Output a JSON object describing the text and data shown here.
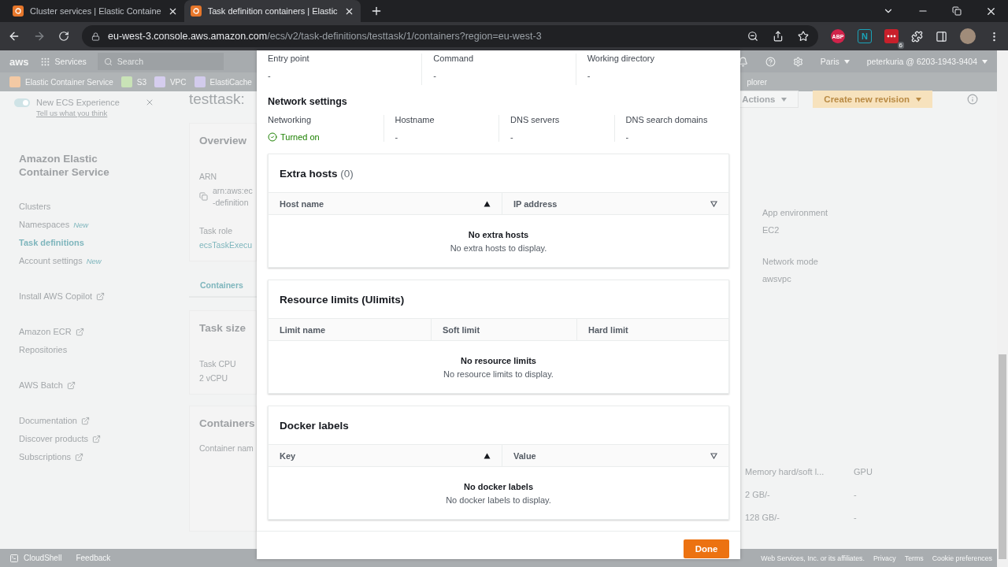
{
  "browser": {
    "tabs": [
      {
        "title": "Cluster services | Elastic Containe",
        "selected": false
      },
      {
        "title": "Task definition containers | Elastic",
        "selected": true
      }
    ],
    "address": {
      "host": "eu-west-3.console.aws.amazon.com",
      "path": "/ecs/v2/task-definitions/testtask/1/containers?region=eu-west-3"
    },
    "extensions": [
      {
        "kind": "abp",
        "label": "ABP"
      },
      {
        "kind": "notion",
        "label": "N"
      },
      {
        "kind": "dots",
        "label": "6"
      }
    ]
  },
  "console": {
    "header": {
      "logo": "aws",
      "services": "Services",
      "search_placeholder": "Search",
      "region": "Paris",
      "account": "peterkuria @ 6203-1943-9404"
    },
    "favorites": [
      {
        "label": "Elastic Container Service",
        "color": "#f3c9a4"
      },
      {
        "label": "S3",
        "color": "#c9e3b7"
      },
      {
        "label": "VPC",
        "color": "#d5cdee"
      },
      {
        "label": "ElastiCache",
        "color": "#d2cbec"
      }
    ],
    "favorites_end": "plorer",
    "banner": {
      "on": true,
      "title": "New ECS Experience",
      "link": "Tell us what you think"
    },
    "nav": {
      "title": "Amazon Elastic Container Service",
      "groups": [
        [
          {
            "label": "Clusters",
            "selected": false,
            "external": false
          },
          {
            "label": "Namespaces",
            "selected": false,
            "badge": "New",
            "external": false
          },
          {
            "label": "Task definitions",
            "selected": true,
            "external": false
          },
          {
            "label": "Account settings",
            "selected": false,
            "badge": "New",
            "external": false
          }
        ],
        [
          {
            "label": "Install AWS Copilot",
            "selected": false,
            "external": true
          }
        ],
        [
          {
            "label": "Amazon ECR",
            "selected": false,
            "external": true
          },
          {
            "label": "Repositories",
            "selected": false,
            "external": false
          }
        ],
        [
          {
            "label": "AWS Batch",
            "selected": false,
            "external": true
          }
        ],
        [
          {
            "label": "Documentation",
            "selected": false,
            "external": true
          },
          {
            "label": "Discover products",
            "selected": false,
            "external": true
          },
          {
            "label": "Subscriptions",
            "selected": false,
            "external": true
          }
        ]
      ]
    },
    "page_title": "testtask:",
    "actions": [
      {
        "label": "Actions",
        "kind": "normal"
      },
      {
        "label": "Create new revision",
        "kind": "primary"
      }
    ],
    "left_panel": {
      "overview": {
        "title": "Overview",
        "arn_label": "ARN",
        "arn_lines": [
          "arn:aws:ec",
          "-definition"
        ],
        "role_label": "Task role",
        "role_value": "ecsTaskExecu"
      },
      "tab": "Containers",
      "task_size": {
        "title": "Task size",
        "cpu_label": "Task CPU",
        "cpu_value": "2 vCPU"
      },
      "containers": {
        "title": "Containers",
        "column": "Container nam"
      }
    },
    "right_panel": {
      "fields": [
        {
          "label": "App environment",
          "value": "EC2"
        },
        {
          "label": "Network mode",
          "value": "awsvpc"
        }
      ],
      "columns": [
        "Memory hard/soft l...",
        "GPU"
      ],
      "rows": [
        [
          "2 GB/-",
          "-"
        ],
        [
          "128 GB/-",
          "-"
        ]
      ]
    },
    "footer": {
      "left": [
        "CloudShell",
        "Feedback"
      ],
      "copyright": "Web Services, Inc. or its affiliates.",
      "links": [
        "Privacy",
        "Terms",
        "Cookie preferences"
      ]
    }
  },
  "modal": {
    "top_fields": [
      {
        "label": "Entry point",
        "value": "-"
      },
      {
        "label": "Command",
        "value": "-"
      },
      {
        "label": "Working directory",
        "value": "-"
      }
    ],
    "network": {
      "title": "Network settings",
      "fields": [
        {
          "label": "Networking",
          "value": "Turned on",
          "kind": "status"
        },
        {
          "label": "Hostname",
          "value": "-",
          "kind": "text"
        },
        {
          "label": "DNS servers",
          "value": "-",
          "kind": "text"
        },
        {
          "label": "DNS search domains",
          "value": "-",
          "kind": "text"
        }
      ]
    },
    "tables": [
      {
        "title": "Extra hosts",
        "count": "(0)",
        "columns": [
          {
            "label": "Host name",
            "sorted": true
          },
          {
            "label": "IP address",
            "sorted": false
          }
        ],
        "empty_title": "No extra hosts",
        "empty_text": "No extra hosts to display."
      },
      {
        "title": "Resource limits (Ulimits)",
        "columns": [
          {
            "label": "Limit name"
          },
          {
            "label": "Soft limit"
          },
          {
            "label": "Hard limit"
          }
        ],
        "empty_title": "No resource limits",
        "empty_text": "No resource limits to display."
      },
      {
        "title": "Docker labels",
        "columns": [
          {
            "label": "Key",
            "sorted": true
          },
          {
            "label": "Value",
            "sorted": false
          }
        ],
        "empty_title": "No docker labels",
        "empty_text": "No docker labels to display."
      }
    ],
    "done": "Done"
  }
}
